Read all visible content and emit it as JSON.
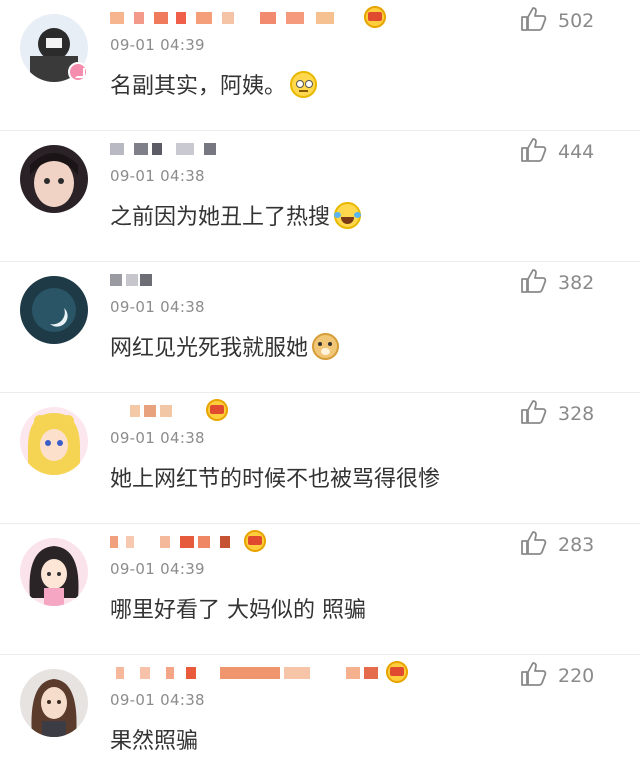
{
  "comments": [
    {
      "time": "09-01 04:39",
      "text": "名副其实，阿姨。",
      "likes": "502",
      "emoji": "rolling-eyes-emoji"
    },
    {
      "time": "09-01 04:38",
      "text": "之前因为她丑上了热搜",
      "likes": "444",
      "emoji": "laughing-tears-emoji"
    },
    {
      "time": "09-01 04:38",
      "text": "网红见光死我就服她",
      "likes": "382",
      "emoji": "doge-emoji"
    },
    {
      "time": "09-01 04:38",
      "text": "她上网红节的时候不也被骂得很惨",
      "likes": "328"
    },
    {
      "time": "09-01 04:39",
      "text": "哪里好看了 大妈似的 照骗",
      "likes": "283"
    },
    {
      "time": "09-01 04:38",
      "text": "果然照骗",
      "likes": "220"
    }
  ],
  "colors": {
    "text": "#333333",
    "meta": "#8c8c8c",
    "divider": "#ececec"
  }
}
